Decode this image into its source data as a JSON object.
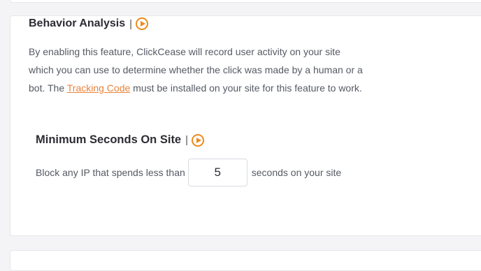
{
  "behavior_analysis": {
    "title": "Behavior Analysis",
    "separator": "|",
    "video_icon": "play-circle-icon",
    "description_before_link": "By enabling this feature, ClickCease will record user activity on your site which you can use to determine whether the click was made by a human or a bot. The ",
    "link_text": "Tracking Code",
    "description_after_link": " must be installed on your site for this feature to work."
  },
  "minimum_seconds": {
    "title": "Minimum Seconds On Site",
    "separator": "|",
    "video_icon": "play-circle-icon",
    "label_before": "Block any IP that spends less than",
    "value": "5",
    "label_after": "seconds on your site"
  },
  "colors": {
    "accent": "#ee8a1e",
    "link": "#e9823a",
    "text": "#555a63",
    "heading": "#2c2c34",
    "background": "#f4f4f6"
  }
}
